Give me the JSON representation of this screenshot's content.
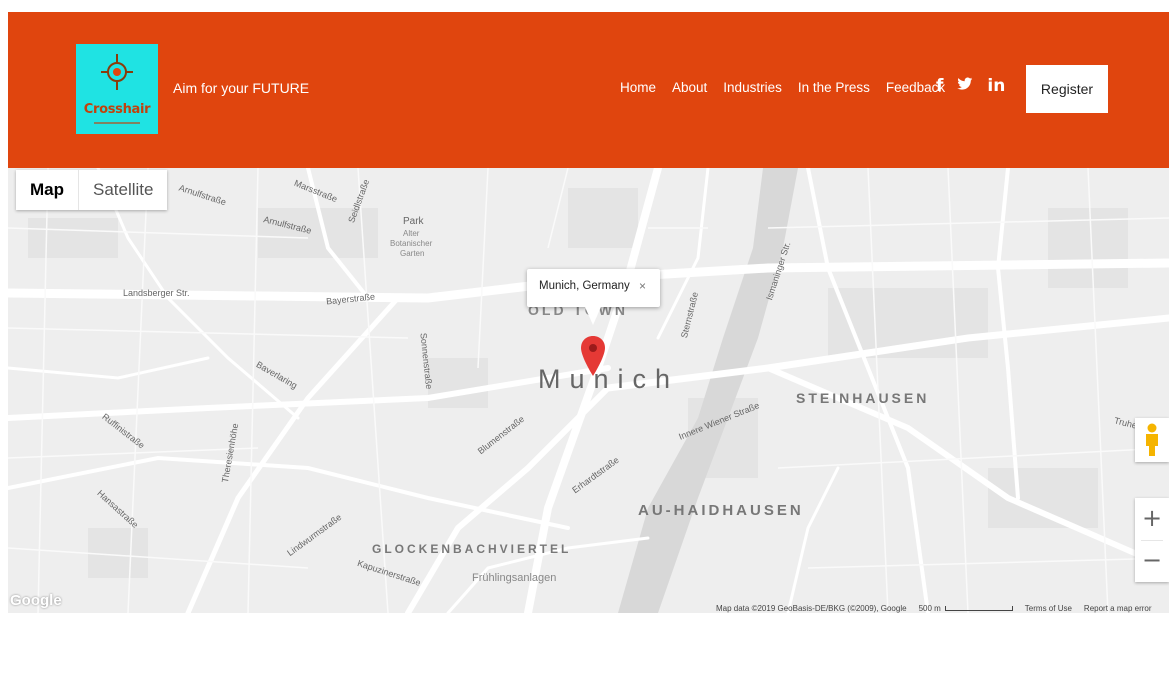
{
  "header": {
    "logo_text": "Crosshair",
    "tagline": "Aim for your FUTURE",
    "nav": [
      "Home",
      "About",
      "Industries",
      "In the Press",
      "Feedback"
    ],
    "social": [
      {
        "icon": "facebook-icon",
        "glyph": "f"
      },
      {
        "icon": "twitter-icon",
        "glyph": "🐦"
      },
      {
        "icon": "linkedin-icon",
        "glyph": "in"
      }
    ],
    "register_label": "Register",
    "colors": {
      "header_bg": "#e0450e",
      "logo_bg": "#1fe3e3"
    }
  },
  "map": {
    "map_types": {
      "active": "Map",
      "inactive": "Satellite"
    },
    "info_window": {
      "title": "Munich, Germany",
      "close": "×"
    },
    "city": "Munich",
    "districts": {
      "steinhausen": "STEINHAUSEN",
      "au_haidhausen": "AU-HAIDHAUSEN",
      "glockenbach": "GLOCKENBACHVIERTEL",
      "old_town": "OLD TOWN"
    },
    "labels": {
      "park": "Park",
      "alter": "Alter",
      "botanischer": "Botanischer",
      "garten": "Garten",
      "landsberger": "Landsberger Str.",
      "bayerstrasse": "Bayerstraße",
      "arnulfstrasse_1": "Arnulfstraße",
      "arnulfstrasse_2": "Arnulfstraße",
      "marsstrasse": "Marsstraße",
      "seidlstrasse": "Seidlstraße",
      "sonnenstrasse": "Sonnenstraße",
      "baversing": "Baverlaring",
      "blumenstrasse": "Blumenstraße",
      "erhardtstrasse": "Erhardtstraße",
      "innere_wiener": "Innere Wiener Straße",
      "ismaninger": "Ismaninger Str.",
      "sternstrasse": "Sternstraße",
      "fruehlingsanlagen": "Frühlingsanlagen",
      "kapuzinerstrasse": "Kapuzinerstraße",
      "lindwurmstrasse": "Lindwurmstraße",
      "theresienhöhe": "Theresienhöhe",
      "ruffinistrasse": "Ruffinistraße",
      "hansastrasse": "Hansastraße",
      "truhe": "Truhe"
    },
    "zoom_in": "+",
    "zoom_out": "−",
    "google_logo": "Google",
    "footer": {
      "data": "Map data ©2019 GeoBasis-DE/BKG (©2009), Google",
      "scale": "500 m",
      "terms": "Terms of Use",
      "report": "Report a map error"
    }
  }
}
